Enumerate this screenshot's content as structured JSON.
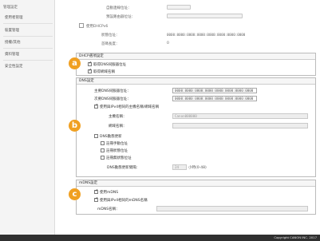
{
  "sidebar": {
    "title": "管理設定",
    "items": [
      {
        "label": "使用者管理"
      },
      {
        "label": "裝置管理"
      },
      {
        "label": "授權/其他"
      },
      {
        "label": "資料管理"
      },
      {
        "label": "安全性設定"
      }
    ]
  },
  "top": {
    "row1_label": "自動連線位址：",
    "row1_value": "",
    "row1_unit": "",
    "row2_label": "預設路由器位址：",
    "row2_value": "",
    "use_dhcpv6_label": "使用DHCPv6",
    "stateful_addr_label": "狀態位址：",
    "stateful_addr_value": "0000:0000:0000:0000:0000:0000:0000:0000",
    "prefix_label": "首碼長度：",
    "prefix_value": "0"
  },
  "panels": {
    "dhcp_options": {
      "title": "DHCP選項設定",
      "options": [
        {
          "label": "取得DNS伺服器位址",
          "checked": true
        },
        {
          "label": "取得網域名稱",
          "checked": true
        }
      ]
    },
    "dns": {
      "title": "DNS設定",
      "primary_dns_label": "主要DNS伺服器位址：",
      "primary_dns_value": "0000:0000:0000:0000:0000:0000:0000:0000",
      "secondary_dns_label": "次要DNS伺服器位址：",
      "secondary_dns_value": "0000:0000:0000:0000:0000:0000:0000:0000",
      "same_as_ipv4_label": "使用與IPv4相同的主機名稱/網域名稱",
      "host_name_label": "主機名稱：",
      "host_name_value": "Canon000000",
      "domain_name_label": "網域名稱：",
      "domain_name_value": "",
      "dynamic_update_label": "DNS動態更新",
      "register_manual_label": "註冊手動位址",
      "register_stateful_label": "註冊狀態位址",
      "register_stateless_label": "註冊無狀態位址",
      "interval_label": "DNS動態更新間隔：",
      "interval_value": "24",
      "interval_unit": "小時(0-48)"
    },
    "mdns": {
      "title": "mDNS設定",
      "use_mdns_label": "使用mDNS",
      "same_name_label": "使用與IPv4相同的mDNS名稱",
      "mdns_name_label": "mDNS名稱：",
      "mdns_name_value": ""
    }
  },
  "callouts": [
    "a",
    "b",
    "c"
  ],
  "footer": {
    "copyright": "Copyright CANON INC. 2017"
  },
  "colors": {
    "callout": "#f0a022",
    "footer_bg": "#303030",
    "sidebar_bg": "#f4f4f4"
  },
  "checks": {
    "use_dhcpv6": false,
    "same_as_ipv4": true,
    "dynamic_update": false,
    "register_manual": false,
    "register_stateful": false,
    "register_stateless": false,
    "use_mdns": true,
    "same_name": true
  }
}
